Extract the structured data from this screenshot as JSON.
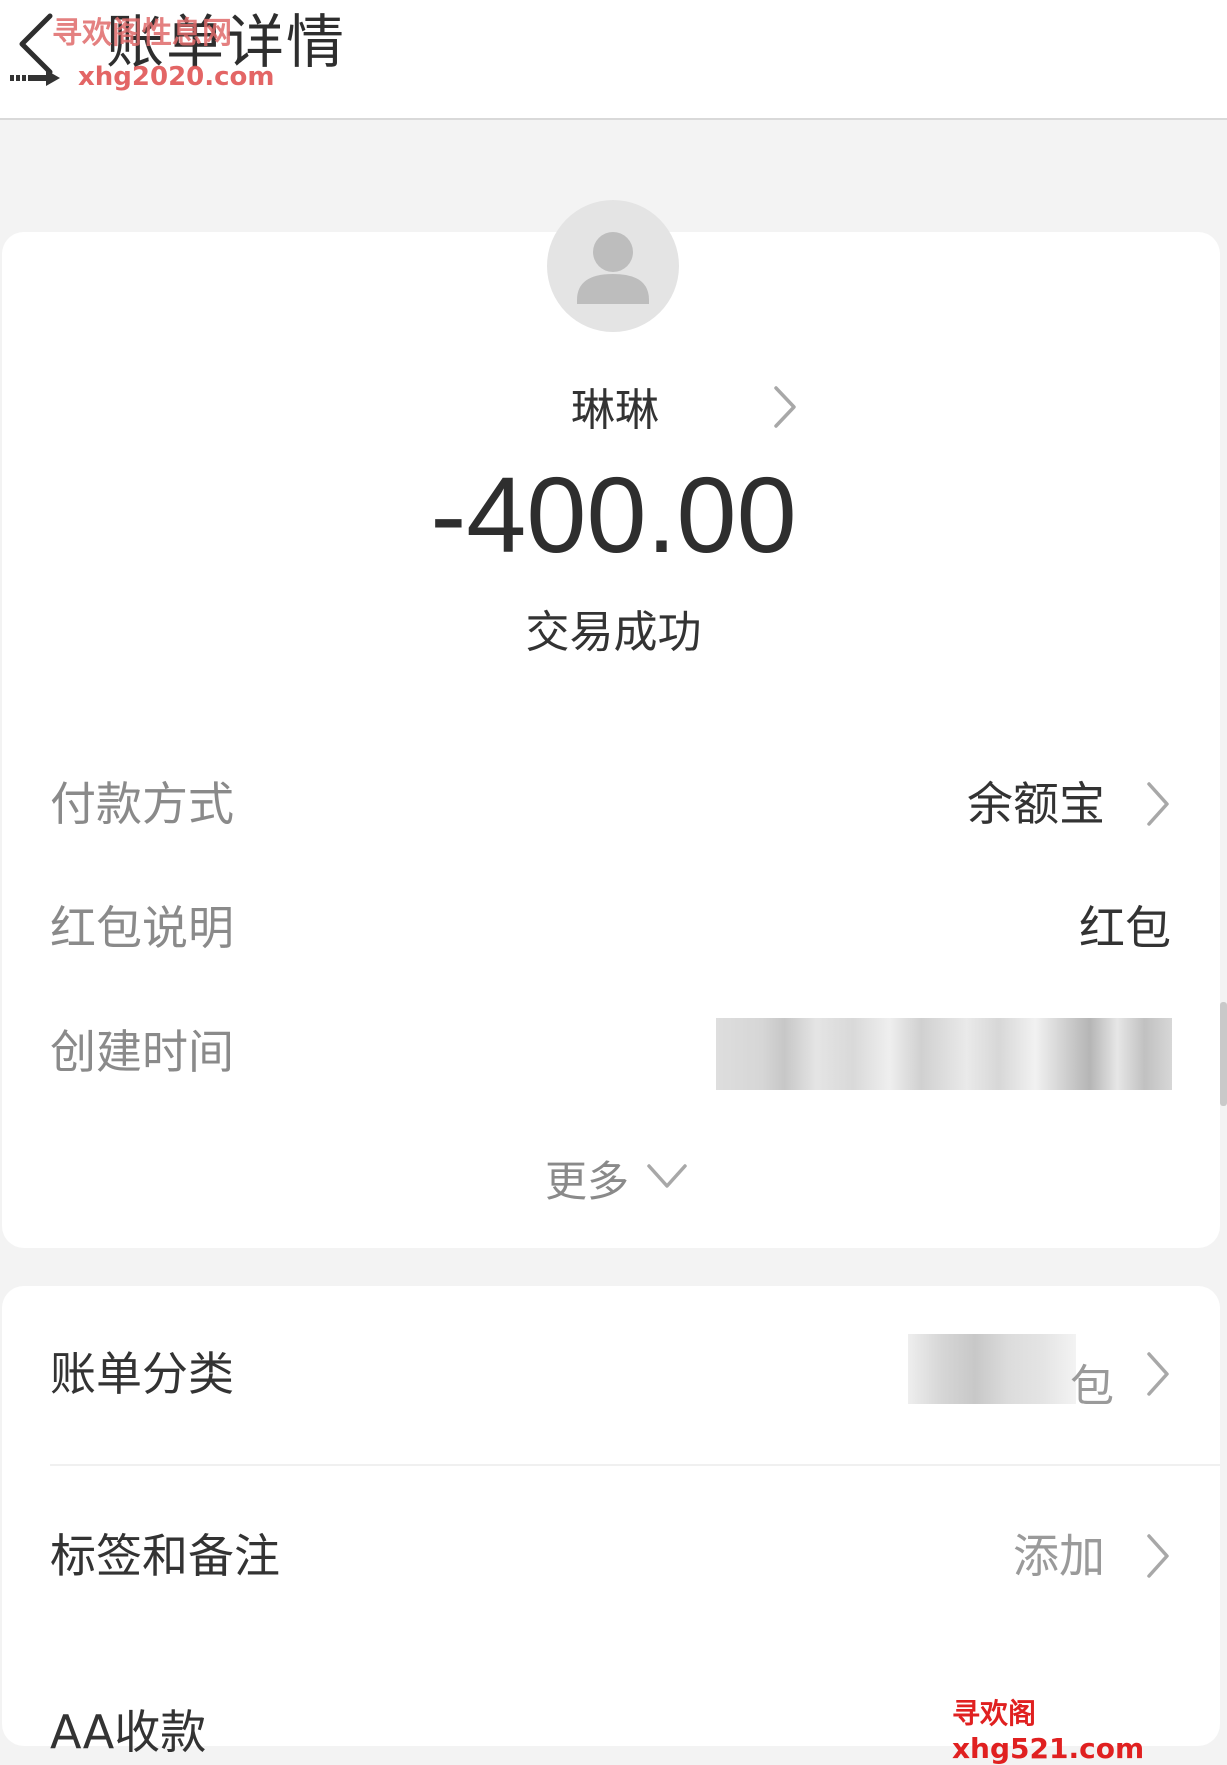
{
  "header": {
    "title": "账单详情",
    "back_icon": "chevron-left-icon"
  },
  "watermarks": {
    "top_cn": "寻欢阁性息网",
    "top_url": "xhg2020.com",
    "bottom": "寻欢阁xhg521.com"
  },
  "transaction": {
    "avatar_icon": "user-silhouette-icon",
    "counterparty": "琳琳",
    "amount": "-400.00",
    "status": "交易成功"
  },
  "details": [
    {
      "label": "付款方式",
      "value": "余额宝"
    },
    {
      "label": "红包说明",
      "value": "红包"
    },
    {
      "label": "创建时间",
      "value": ""
    }
  ],
  "more": {
    "label": "更多"
  },
  "extra": {
    "category_label": "账单分类",
    "category_value_tail": "包",
    "tags_label": "标签和备注",
    "tags_value": "添加",
    "aa_label": "AA收款"
  }
}
